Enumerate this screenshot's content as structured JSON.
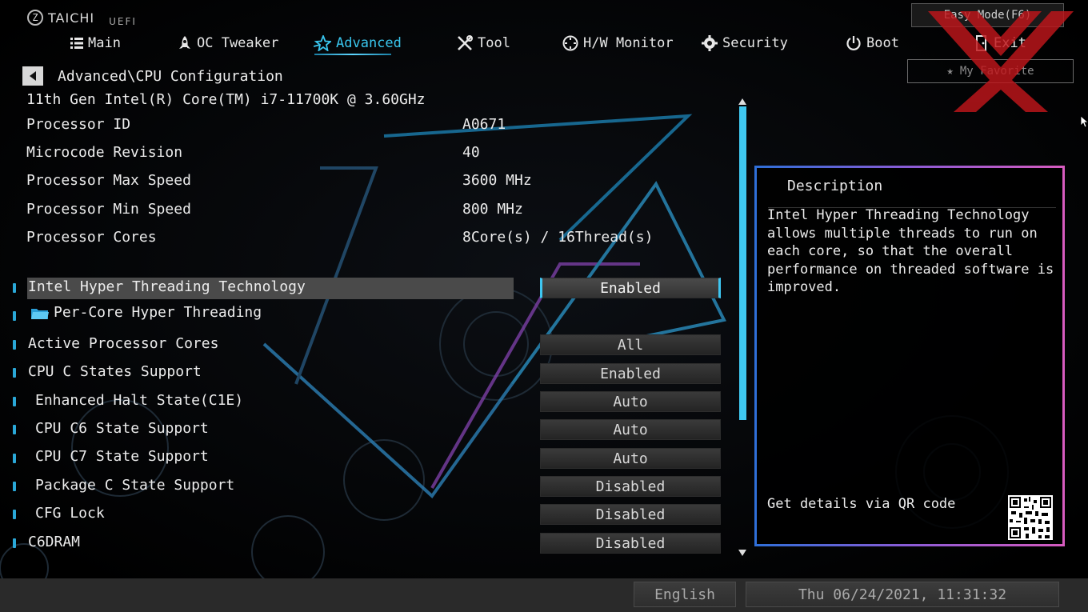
{
  "brand": {
    "name": "TAICHI",
    "suffix": "UEFI"
  },
  "nav": {
    "items": [
      {
        "label": "Main",
        "icon": "list-icon"
      },
      {
        "label": "OC Tweaker",
        "icon": "rocket-icon"
      },
      {
        "label": "Advanced",
        "icon": "star-icon",
        "active": true
      },
      {
        "label": "Tool",
        "icon": "tools-icon"
      },
      {
        "label": "H/W Monitor",
        "icon": "monitor-icon"
      },
      {
        "label": "Security",
        "icon": "gear-shield-icon"
      },
      {
        "label": "Boot",
        "icon": "power-icon"
      },
      {
        "label": "Exit",
        "icon": "exit-icon"
      }
    ]
  },
  "top_buttons": {
    "easy_mode": "Easy Mode(F6)",
    "favorite": "My Favorite"
  },
  "breadcrumb": {
    "path": "Advanced\\CPU Configuration"
  },
  "cpu": {
    "model": "11th Gen Intel(R) Core(TM) i7-11700K @ 3.60GHz",
    "info": [
      {
        "label": "Processor ID",
        "value": "A0671"
      },
      {
        "label": "Microcode Revision",
        "value": "40"
      },
      {
        "label": "Processor Max Speed",
        "value": "3600 MHz"
      },
      {
        "label": "Processor Min Speed",
        "value": "800 MHz"
      },
      {
        "label": "Processor Cores",
        "value": "8Core(s) / 16Thread(s)"
      }
    ]
  },
  "settings": [
    {
      "label": "Intel Hyper Threading Technology",
      "value": "Enabled",
      "selected": true
    },
    {
      "label": "Per-Core Hyper Threading",
      "value": null,
      "submenu": true
    },
    {
      "label": "Active Processor Cores",
      "value": "All"
    },
    {
      "label": "CPU C States Support",
      "value": "Enabled"
    },
    {
      "label": "Enhanced Halt State(C1E)",
      "value": "Auto"
    },
    {
      "label": "CPU C6 State Support",
      "value": "Auto"
    },
    {
      "label": "CPU C7 State Support",
      "value": "Auto"
    },
    {
      "label": "Package C State Support",
      "value": "Disabled"
    },
    {
      "label": "CFG Lock",
      "value": "Disabled"
    },
    {
      "label": "C6DRAM",
      "value": "Disabled"
    }
  ],
  "description": {
    "title": "Description",
    "body": "Intel Hyper Threading Technology\nallows multiple threads to run on\neach core, so that the overall\nperformance on threaded software is\nimproved.",
    "qr_label": "Get details via QR code"
  },
  "footer": {
    "language": "English",
    "datetime": "Thu 06/24/2021, 11:31:32"
  },
  "colors": {
    "accent": "#3ec6f2",
    "panel_border_start": "#2f6fd8",
    "panel_border_end": "#d65bbf"
  }
}
